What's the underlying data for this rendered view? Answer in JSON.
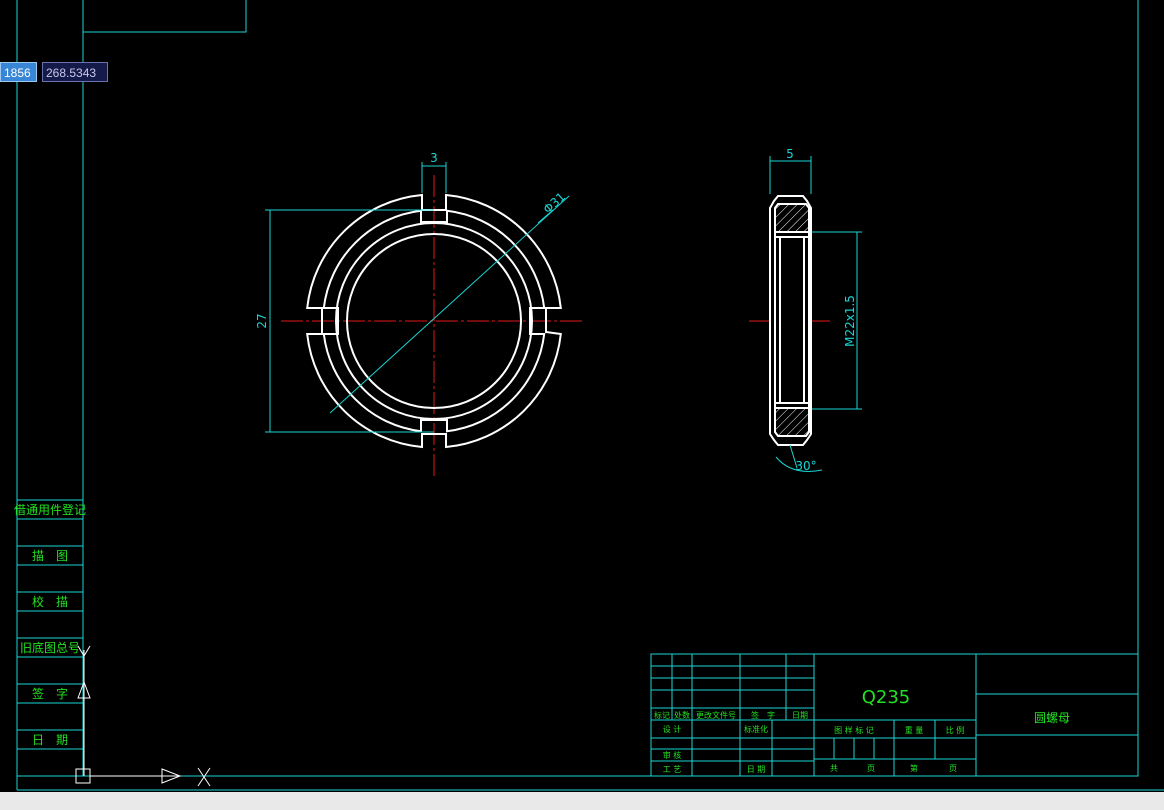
{
  "cursor_input": {
    "x_value": "1856",
    "y_value": "268.5343"
  },
  "drawing": {
    "dimensions": {
      "slot_width": "3",
      "outer_diameter": "Φ31",
      "height": "27",
      "thickness": "5",
      "thread": "M22x1.5",
      "chamfer_angle": "30°"
    }
  },
  "side_strip": {
    "labels": [
      "借通用件登记",
      "描　图",
      "校　描",
      "旧底图总号",
      "签　字",
      "日　期"
    ]
  },
  "title_block": {
    "material": "Q235",
    "part_name": "圆螺母",
    "change_header": [
      "标记",
      "处数",
      "更改文件号",
      "签　字",
      "日期"
    ],
    "row_design": [
      "设 计",
      "标准化"
    ],
    "row_review": "审 核",
    "row_process": [
      "工 艺",
      "日 期"
    ],
    "stage_header": [
      "图 样 标 记",
      "重 量",
      "比 例"
    ],
    "sheets": [
      "共",
      "页",
      "第",
      "页"
    ]
  },
  "colors": {
    "geometry": "#ffffff",
    "dimension": "#19d4d4",
    "centerline": "#e01818",
    "border": "#19d4d4",
    "title_text": "#22e022"
  }
}
